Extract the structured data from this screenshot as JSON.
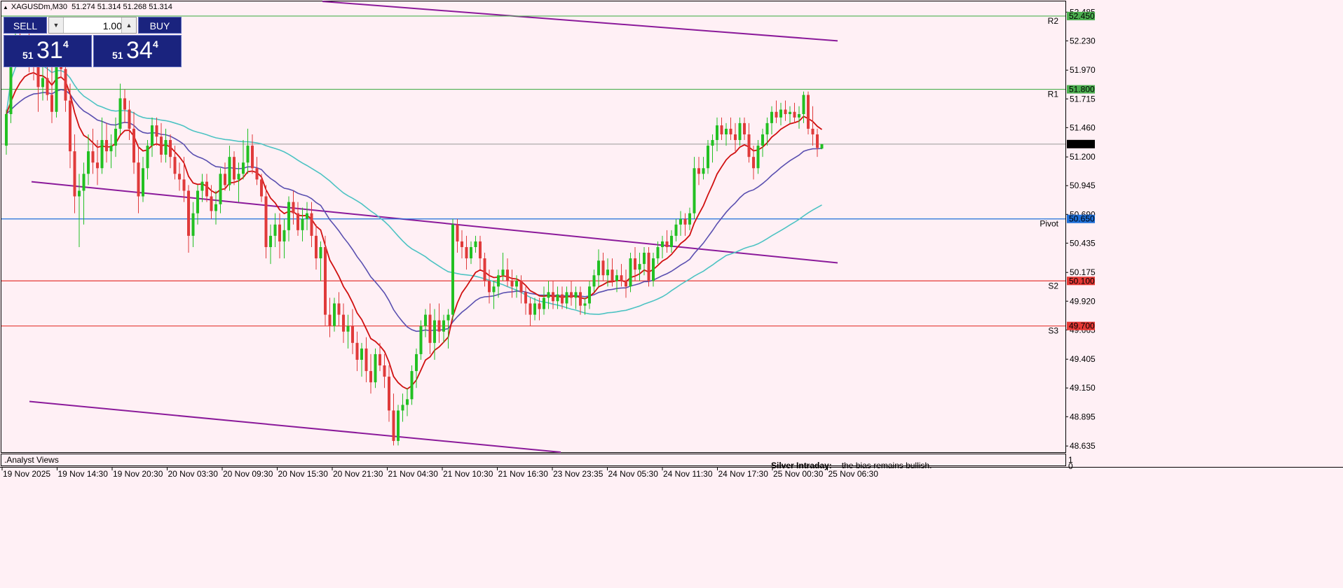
{
  "header": {
    "symbol_line": "XAGUSDm,M30  51.274 51.314 51.268 51.314"
  },
  "trade_panel": {
    "sell_label": "SELL",
    "buy_label": "BUY",
    "lot_value": "1.00",
    "sell_price": {
      "prefix": "51",
      "big": "31",
      "sup": "4"
    },
    "buy_price": {
      "prefix": "51",
      "big": "34",
      "sup": "4"
    }
  },
  "price_axis": {
    "ticks": [
      "52.485",
      "52.230",
      "51.970",
      "51.715",
      "51.460",
      "51.200",
      "50.945",
      "50.690",
      "50.435",
      "50.175",
      "49.920",
      "49.665",
      "49.405",
      "49.150",
      "48.895",
      "48.635"
    ],
    "current_price": "51.314"
  },
  "levels": [
    {
      "label": "R2",
      "value": "52.450",
      "price": 52.45,
      "color": "#4caf50"
    },
    {
      "label": "R1",
      "value": "51.800",
      "price": 51.8,
      "color": "#4caf50"
    },
    {
      "label": "Pivot",
      "value": "50.650",
      "price": 50.65,
      "color": "#1e6fd9"
    },
    {
      "label": "S2",
      "value": "50.100",
      "price": 50.1,
      "color": "#e53935"
    },
    {
      "label": "S3",
      "value": "49.700",
      "price": 49.7,
      "color": "#e53935"
    }
  ],
  "time_axis": {
    "labels": [
      "19 Nov 2025",
      "19 Nov 14:30",
      "19 Nov 20:30",
      "20 Nov 03:30",
      "20 Nov 09:30",
      "20 Nov 15:30",
      "20 Nov 21:30",
      "21 Nov 04:30",
      "21 Nov 10:30",
      "21 Nov 16:30",
      "23 Nov 23:35",
      "24 Nov 05:30",
      "24 Nov 11:30",
      "24 Nov 17:30",
      "25 Nov 00:30",
      "25 Nov 06:30"
    ]
  },
  "subwindow": {
    "label": ".Analyst Views",
    "scale_top": "1",
    "scale_bottom": "0"
  },
  "analyst_view": {
    "title": "Silver Intraday:",
    "text": "the bias remains bullish."
  },
  "colors": {
    "background": "#fff0f5",
    "bull": "#22c022",
    "bear": "#e03a3a",
    "ma_fast": "#d01010",
    "ma_mid": "#5a4fb0",
    "ma_slow": "#4dc3c3",
    "channel": "#8b1a9a"
  },
  "chart_data": {
    "type": "candlestick",
    "symbol": "XAGUSDm",
    "timeframe": "M30",
    "ylim": [
      48.58,
      52.58
    ],
    "candles": [
      {
        "o": 51.3,
        "h": 51.62,
        "l": 51.22,
        "c": 51.58
      },
      {
        "o": 51.58,
        "h": 52.25,
        "l": 51.5,
        "c": 52.18
      },
      {
        "o": 52.18,
        "h": 52.36,
        "l": 52.05,
        "c": 52.22
      },
      {
        "o": 52.22,
        "h": 52.32,
        "l": 52.1,
        "c": 52.18
      },
      {
        "o": 52.18,
        "h": 52.28,
        "l": 52.1,
        "c": 52.15
      },
      {
        "o": 52.15,
        "h": 52.3,
        "l": 51.95,
        "c": 52.05
      },
      {
        "o": 52.05,
        "h": 52.2,
        "l": 51.88,
        "c": 52.0
      },
      {
        "o": 52.0,
        "h": 52.12,
        "l": 51.6,
        "c": 51.82
      },
      {
        "o": 51.82,
        "h": 52.1,
        "l": 51.7,
        "c": 51.9
      },
      {
        "o": 51.9,
        "h": 52.05,
        "l": 51.7,
        "c": 51.75
      },
      {
        "o": 51.75,
        "h": 52.0,
        "l": 51.5,
        "c": 51.6
      },
      {
        "o": 51.6,
        "h": 52.2,
        "l": 51.55,
        "c": 52.15
      },
      {
        "o": 52.15,
        "h": 52.25,
        "l": 51.9,
        "c": 51.98
      },
      {
        "o": 51.98,
        "h": 52.05,
        "l": 51.6,
        "c": 51.7
      },
      {
        "o": 51.7,
        "h": 51.85,
        "l": 51.1,
        "c": 51.25
      },
      {
        "o": 51.25,
        "h": 51.4,
        "l": 50.7,
        "c": 50.85
      },
      {
        "o": 50.85,
        "h": 51.05,
        "l": 50.4,
        "c": 50.9
      },
      {
        "o": 50.9,
        "h": 51.15,
        "l": 50.6,
        "c": 51.05
      },
      {
        "o": 51.05,
        "h": 51.4,
        "l": 50.95,
        "c": 51.25
      },
      {
        "o": 51.25,
        "h": 51.45,
        "l": 51.05,
        "c": 51.15
      },
      {
        "o": 51.15,
        "h": 51.35,
        "l": 50.95,
        "c": 51.1
      },
      {
        "o": 51.1,
        "h": 51.55,
        "l": 51.05,
        "c": 51.35
      },
      {
        "o": 51.35,
        "h": 51.5,
        "l": 51.15,
        "c": 51.25
      },
      {
        "o": 51.25,
        "h": 51.4,
        "l": 51.1,
        "c": 51.3
      },
      {
        "o": 51.3,
        "h": 51.55,
        "l": 51.2,
        "c": 51.45
      },
      {
        "o": 51.45,
        "h": 51.85,
        "l": 51.4,
        "c": 51.72
      },
      {
        "o": 51.72,
        "h": 51.8,
        "l": 51.5,
        "c": 51.62
      },
      {
        "o": 51.62,
        "h": 51.7,
        "l": 51.35,
        "c": 51.45
      },
      {
        "o": 51.45,
        "h": 51.6,
        "l": 51.05,
        "c": 51.15
      },
      {
        "o": 51.15,
        "h": 51.3,
        "l": 50.7,
        "c": 50.85
      },
      {
        "o": 50.85,
        "h": 51.2,
        "l": 50.8,
        "c": 51.1
      },
      {
        "o": 51.1,
        "h": 51.35,
        "l": 51.0,
        "c": 51.3
      },
      {
        "o": 51.3,
        "h": 51.55,
        "l": 51.2,
        "c": 51.48
      },
      {
        "o": 51.48,
        "h": 51.55,
        "l": 51.3,
        "c": 51.38
      },
      {
        "o": 51.38,
        "h": 51.5,
        "l": 51.15,
        "c": 51.22
      },
      {
        "o": 51.22,
        "h": 51.45,
        "l": 51.15,
        "c": 51.35
      },
      {
        "o": 51.35,
        "h": 51.4,
        "l": 51.1,
        "c": 51.2
      },
      {
        "o": 51.2,
        "h": 51.3,
        "l": 51.0,
        "c": 51.05
      },
      {
        "o": 51.05,
        "h": 51.15,
        "l": 50.9,
        "c": 51.0
      },
      {
        "o": 51.0,
        "h": 51.2,
        "l": 50.8,
        "c": 50.9
      },
      {
        "o": 50.9,
        "h": 50.95,
        "l": 50.35,
        "c": 50.5
      },
      {
        "o": 50.5,
        "h": 50.8,
        "l": 50.4,
        "c": 50.7
      },
      {
        "o": 50.7,
        "h": 50.95,
        "l": 50.6,
        "c": 50.9
      },
      {
        "o": 50.9,
        "h": 51.05,
        "l": 50.8,
        "c": 50.98
      },
      {
        "o": 50.98,
        "h": 51.05,
        "l": 50.8,
        "c": 50.85
      },
      {
        "o": 50.85,
        "h": 50.95,
        "l": 50.65,
        "c": 50.72
      },
      {
        "o": 50.72,
        "h": 50.9,
        "l": 50.6,
        "c": 50.78
      },
      {
        "o": 50.78,
        "h": 51.1,
        "l": 50.7,
        "c": 51.05
      },
      {
        "o": 51.05,
        "h": 51.15,
        "l": 50.9,
        "c": 50.95
      },
      {
        "o": 50.95,
        "h": 51.3,
        "l": 50.9,
        "c": 51.2
      },
      {
        "o": 51.2,
        "h": 51.25,
        "l": 50.95,
        "c": 51.0
      },
      {
        "o": 51.0,
        "h": 51.15,
        "l": 50.8,
        "c": 51.05
      },
      {
        "o": 51.05,
        "h": 51.35,
        "l": 51.0,
        "c": 51.15
      },
      {
        "o": 51.15,
        "h": 51.45,
        "l": 51.05,
        "c": 51.3
      },
      {
        "o": 51.3,
        "h": 51.4,
        "l": 51.05,
        "c": 51.1
      },
      {
        "o": 51.1,
        "h": 51.2,
        "l": 50.95,
        "c": 51.0
      },
      {
        "o": 51.0,
        "h": 51.05,
        "l": 50.8,
        "c": 50.85
      },
      {
        "o": 50.85,
        "h": 50.95,
        "l": 50.3,
        "c": 50.4
      },
      {
        "o": 50.4,
        "h": 50.6,
        "l": 50.25,
        "c": 50.5
      },
      {
        "o": 50.5,
        "h": 50.7,
        "l": 50.4,
        "c": 50.6
      },
      {
        "o": 50.6,
        "h": 50.7,
        "l": 50.3,
        "c": 50.45
      },
      {
        "o": 50.45,
        "h": 50.65,
        "l": 50.3,
        "c": 50.55
      },
      {
        "o": 50.55,
        "h": 50.85,
        "l": 50.45,
        "c": 50.8
      },
      {
        "o": 50.8,
        "h": 50.9,
        "l": 50.6,
        "c": 50.7
      },
      {
        "o": 50.7,
        "h": 50.8,
        "l": 50.5,
        "c": 50.55
      },
      {
        "o": 50.55,
        "h": 50.75,
        "l": 50.45,
        "c": 50.65
      },
      {
        "o": 50.65,
        "h": 50.8,
        "l": 50.55,
        "c": 50.7
      },
      {
        "o": 50.7,
        "h": 50.8,
        "l": 50.4,
        "c": 50.5
      },
      {
        "o": 50.5,
        "h": 50.6,
        "l": 50.2,
        "c": 50.3
      },
      {
        "o": 50.3,
        "h": 50.45,
        "l": 50.1,
        "c": 50.4
      },
      {
        "o": 50.4,
        "h": 50.5,
        "l": 49.7,
        "c": 49.8
      },
      {
        "o": 49.8,
        "h": 49.95,
        "l": 49.6,
        "c": 49.7
      },
      {
        "o": 49.7,
        "h": 49.95,
        "l": 49.65,
        "c": 49.9
      },
      {
        "o": 49.9,
        "h": 50.0,
        "l": 49.7,
        "c": 49.8
      },
      {
        "o": 49.8,
        "h": 49.9,
        "l": 49.55,
        "c": 49.65
      },
      {
        "o": 49.65,
        "h": 49.8,
        "l": 49.5,
        "c": 49.7
      },
      {
        "o": 49.7,
        "h": 49.85,
        "l": 49.45,
        "c": 49.55
      },
      {
        "o": 49.55,
        "h": 49.65,
        "l": 49.3,
        "c": 49.4
      },
      {
        "o": 49.4,
        "h": 49.55,
        "l": 49.25,
        "c": 49.5
      },
      {
        "o": 49.5,
        "h": 49.6,
        "l": 49.2,
        "c": 49.3
      },
      {
        "o": 49.3,
        "h": 49.45,
        "l": 49.1,
        "c": 49.2
      },
      {
        "o": 49.2,
        "h": 49.5,
        "l": 49.15,
        "c": 49.45
      },
      {
        "o": 49.45,
        "h": 49.55,
        "l": 49.3,
        "c": 49.35
      },
      {
        "o": 49.35,
        "h": 49.45,
        "l": 49.15,
        "c": 49.25
      },
      {
        "o": 49.25,
        "h": 49.35,
        "l": 48.85,
        "c": 48.95
      },
      {
        "o": 48.95,
        "h": 49.1,
        "l": 48.64,
        "c": 48.68
      },
      {
        "o": 48.68,
        "h": 49.0,
        "l": 48.64,
        "c": 48.95
      },
      {
        "o": 48.95,
        "h": 49.1,
        "l": 48.85,
        "c": 49.0
      },
      {
        "o": 49.0,
        "h": 49.15,
        "l": 48.9,
        "c": 49.05
      },
      {
        "o": 49.05,
        "h": 49.35,
        "l": 49.0,
        "c": 49.3
      },
      {
        "o": 49.3,
        "h": 49.5,
        "l": 49.15,
        "c": 49.45
      },
      {
        "o": 49.45,
        "h": 49.75,
        "l": 49.4,
        "c": 49.7
      },
      {
        "o": 49.7,
        "h": 49.85,
        "l": 49.6,
        "c": 49.8
      },
      {
        "o": 49.8,
        "h": 49.9,
        "l": 49.45,
        "c": 49.55
      },
      {
        "o": 49.55,
        "h": 49.85,
        "l": 49.4,
        "c": 49.75
      },
      {
        "o": 49.75,
        "h": 49.9,
        "l": 49.55,
        "c": 49.65
      },
      {
        "o": 49.65,
        "h": 49.8,
        "l": 49.55,
        "c": 49.75
      },
      {
        "o": 49.75,
        "h": 49.85,
        "l": 49.5,
        "c": 49.8
      },
      {
        "o": 49.8,
        "h": 50.65,
        "l": 49.75,
        "c": 50.6
      },
      {
        "o": 50.6,
        "h": 50.65,
        "l": 50.35,
        "c": 50.45
      },
      {
        "o": 50.45,
        "h": 50.55,
        "l": 50.3,
        "c": 50.4
      },
      {
        "o": 50.4,
        "h": 50.5,
        "l": 50.2,
        "c": 50.3
      },
      {
        "o": 50.3,
        "h": 50.45,
        "l": 50.25,
        "c": 50.4
      },
      {
        "o": 50.4,
        "h": 50.5,
        "l": 50.35,
        "c": 50.45
      },
      {
        "o": 50.45,
        "h": 50.5,
        "l": 50.2,
        "c": 50.3
      },
      {
        "o": 50.3,
        "h": 50.35,
        "l": 50.05,
        "c": 50.1
      },
      {
        "o": 50.1,
        "h": 50.2,
        "l": 49.9,
        "c": 50.0
      },
      {
        "o": 50.0,
        "h": 50.1,
        "l": 49.85,
        "c": 50.05
      },
      {
        "o": 50.05,
        "h": 50.2,
        "l": 49.95,
        "c": 50.15
      },
      {
        "o": 50.15,
        "h": 50.35,
        "l": 50.1,
        "c": 50.2
      },
      {
        "o": 50.2,
        "h": 50.3,
        "l": 50.05,
        "c": 50.1
      },
      {
        "o": 50.1,
        "h": 50.2,
        "l": 49.95,
        "c": 50.05
      },
      {
        "o": 50.05,
        "h": 50.15,
        "l": 49.95,
        "c": 50.1
      },
      {
        "o": 50.1,
        "h": 50.15,
        "l": 49.9,
        "c": 50.0
      },
      {
        "o": 50.0,
        "h": 50.05,
        "l": 49.8,
        "c": 49.9
      },
      {
        "o": 49.9,
        "h": 49.95,
        "l": 49.7,
        "c": 49.8
      },
      {
        "o": 49.8,
        "h": 49.95,
        "l": 49.75,
        "c": 49.9
      },
      {
        "o": 49.9,
        "h": 49.95,
        "l": 49.75,
        "c": 49.85
      },
      {
        "o": 49.85,
        "h": 50.05,
        "l": 49.8,
        "c": 49.95
      },
      {
        "o": 49.95,
        "h": 50.1,
        "l": 49.85,
        "c": 50.0
      },
      {
        "o": 50.0,
        "h": 50.1,
        "l": 49.85,
        "c": 49.92
      },
      {
        "o": 49.92,
        "h": 50.05,
        "l": 49.85,
        "c": 49.98
      },
      {
        "o": 49.98,
        "h": 50.05,
        "l": 49.85,
        "c": 49.9
      },
      {
        "o": 49.9,
        "h": 50.05,
        "l": 49.85,
        "c": 50.0
      },
      {
        "o": 50.0,
        "h": 50.1,
        "l": 49.88,
        "c": 49.95
      },
      {
        "o": 49.95,
        "h": 50.05,
        "l": 49.85,
        "c": 50.0
      },
      {
        "o": 50.0,
        "h": 50.05,
        "l": 49.8,
        "c": 49.88
      },
      {
        "o": 49.88,
        "h": 49.95,
        "l": 49.8,
        "c": 49.9
      },
      {
        "o": 49.9,
        "h": 50.1,
        "l": 49.85,
        "c": 50.05
      },
      {
        "o": 50.05,
        "h": 50.2,
        "l": 50.0,
        "c": 50.15
      },
      {
        "o": 50.15,
        "h": 50.38,
        "l": 50.05,
        "c": 50.28
      },
      {
        "o": 50.28,
        "h": 50.35,
        "l": 50.1,
        "c": 50.15
      },
      {
        "o": 50.15,
        "h": 50.3,
        "l": 50.05,
        "c": 50.2
      },
      {
        "o": 50.2,
        "h": 50.3,
        "l": 50.05,
        "c": 50.1
      },
      {
        "o": 50.1,
        "h": 50.2,
        "l": 50.0,
        "c": 50.15
      },
      {
        "o": 50.15,
        "h": 50.25,
        "l": 50.05,
        "c": 50.1
      },
      {
        "o": 50.1,
        "h": 50.2,
        "l": 49.95,
        "c": 50.05
      },
      {
        "o": 50.05,
        "h": 50.35,
        "l": 50.0,
        "c": 50.3
      },
      {
        "o": 50.3,
        "h": 50.4,
        "l": 50.1,
        "c": 50.2
      },
      {
        "o": 50.2,
        "h": 50.35,
        "l": 50.1,
        "c": 50.25
      },
      {
        "o": 50.25,
        "h": 50.4,
        "l": 50.15,
        "c": 50.35
      },
      {
        "o": 50.35,
        "h": 50.4,
        "l": 50.05,
        "c": 50.1
      },
      {
        "o": 50.1,
        "h": 50.35,
        "l": 50.05,
        "c": 50.3
      },
      {
        "o": 50.3,
        "h": 50.45,
        "l": 50.25,
        "c": 50.4
      },
      {
        "o": 50.4,
        "h": 50.5,
        "l": 50.3,
        "c": 50.45
      },
      {
        "o": 50.45,
        "h": 50.55,
        "l": 50.35,
        "c": 50.4
      },
      {
        "o": 50.4,
        "h": 50.55,
        "l": 50.35,
        "c": 50.5
      },
      {
        "o": 50.5,
        "h": 50.65,
        "l": 50.45,
        "c": 50.6
      },
      {
        "o": 50.6,
        "h": 50.72,
        "l": 50.5,
        "c": 50.65
      },
      {
        "o": 50.65,
        "h": 50.7,
        "l": 50.5,
        "c": 50.6
      },
      {
        "o": 50.6,
        "h": 50.75,
        "l": 50.55,
        "c": 50.7
      },
      {
        "o": 50.7,
        "h": 51.2,
        "l": 50.65,
        "c": 51.1
      },
      {
        "o": 51.1,
        "h": 51.2,
        "l": 50.95,
        "c": 51.05
      },
      {
        "o": 51.05,
        "h": 51.2,
        "l": 51.0,
        "c": 51.1
      },
      {
        "o": 51.1,
        "h": 51.35,
        "l": 51.05,
        "c": 51.3
      },
      {
        "o": 51.3,
        "h": 51.4,
        "l": 51.15,
        "c": 51.35
      },
      {
        "o": 51.35,
        "h": 51.55,
        "l": 51.25,
        "c": 51.48
      },
      {
        "o": 51.48,
        "h": 51.55,
        "l": 51.35,
        "c": 51.4
      },
      {
        "o": 51.4,
        "h": 51.5,
        "l": 51.3,
        "c": 51.45
      },
      {
        "o": 51.45,
        "h": 51.55,
        "l": 51.35,
        "c": 51.4
      },
      {
        "o": 51.4,
        "h": 51.5,
        "l": 51.25,
        "c": 51.35
      },
      {
        "o": 51.35,
        "h": 51.55,
        "l": 51.3,
        "c": 51.5
      },
      {
        "o": 51.5,
        "h": 51.55,
        "l": 51.35,
        "c": 51.4
      },
      {
        "o": 51.4,
        "h": 51.5,
        "l": 51.15,
        "c": 51.2
      },
      {
        "o": 51.2,
        "h": 51.3,
        "l": 51.0,
        "c": 51.1
      },
      {
        "o": 51.1,
        "h": 51.35,
        "l": 51.05,
        "c": 51.3
      },
      {
        "o": 51.3,
        "h": 51.45,
        "l": 51.2,
        "c": 51.4
      },
      {
        "o": 51.4,
        "h": 51.55,
        "l": 51.3,
        "c": 51.5
      },
      {
        "o": 51.5,
        "h": 51.65,
        "l": 51.4,
        "c": 51.6
      },
      {
        "o": 51.6,
        "h": 51.7,
        "l": 51.5,
        "c": 51.55
      },
      {
        "o": 51.55,
        "h": 51.68,
        "l": 51.48,
        "c": 51.62
      },
      {
        "o": 51.62,
        "h": 51.7,
        "l": 51.52,
        "c": 51.58
      },
      {
        "o": 51.58,
        "h": 51.65,
        "l": 51.5,
        "c": 51.6
      },
      {
        "o": 51.6,
        "h": 51.68,
        "l": 51.5,
        "c": 51.55
      },
      {
        "o": 51.55,
        "h": 51.65,
        "l": 51.45,
        "c": 51.58
      },
      {
        "o": 51.58,
        "h": 51.78,
        "l": 51.5,
        "c": 51.75
      },
      {
        "o": 51.75,
        "h": 51.78,
        "l": 51.4,
        "c": 51.45
      },
      {
        "o": 51.45,
        "h": 51.65,
        "l": 51.3,
        "c": 51.4
      },
      {
        "o": 51.4,
        "h": 51.45,
        "l": 51.2,
        "c": 51.28
      },
      {
        "o": 51.274,
        "h": 51.314,
        "l": 51.268,
        "c": 51.314
      }
    ]
  }
}
